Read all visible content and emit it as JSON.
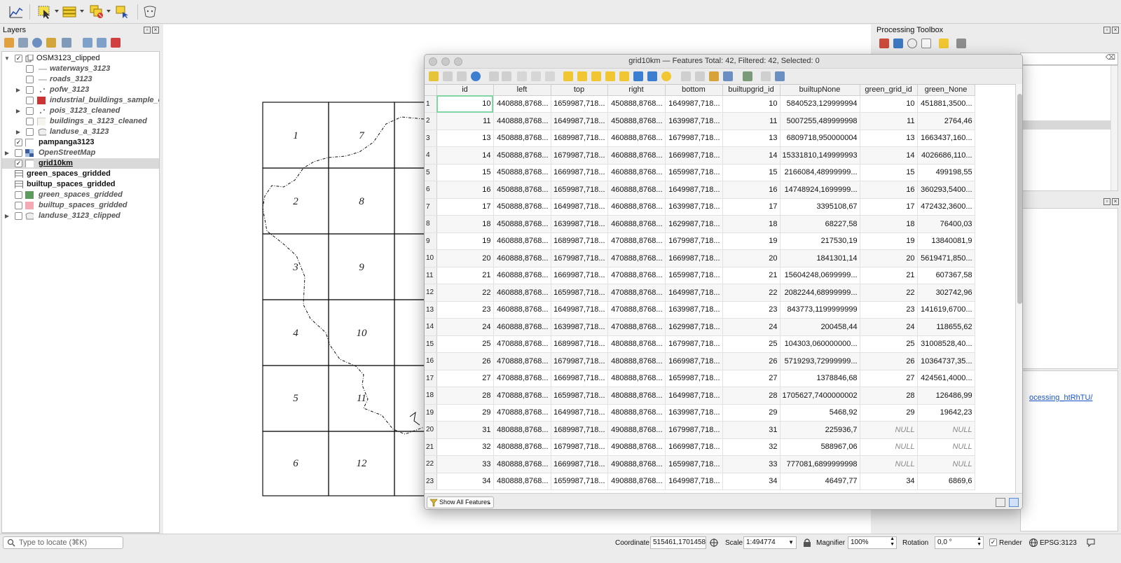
{
  "layers": {
    "title": "Layers",
    "items": [
      {
        "label": "OSM3123_clipped"
      },
      {
        "label": "waterways_3123"
      },
      {
        "label": "roads_3123"
      },
      {
        "label": "pofw_3123"
      },
      {
        "label": "industrial_buildings_sample_cl"
      },
      {
        "label": "pois_3123_cleaned"
      },
      {
        "label": "buildings_a_3123_cleaned"
      },
      {
        "label": "landuse_a_3123"
      },
      {
        "label": "pampanga3123"
      },
      {
        "label": "OpenStreetMap"
      },
      {
        "label": "grid10km"
      },
      {
        "label": "green_spaces_gridded"
      },
      {
        "label": "builtup_spaces_gridded"
      },
      {
        "label": "green_spaces_gridded"
      },
      {
        "label": "builtup_spaces_gridded"
      },
      {
        "label": "landuse_3123_clipped"
      }
    ]
  },
  "map": {
    "cells": [
      "1",
      "2",
      "3",
      "4",
      "5",
      "6",
      "7",
      "8",
      "9",
      "10",
      "11",
      "12"
    ]
  },
  "processing": {
    "title": "Processing Toolbox",
    "link_text": "ocessing_htRhTU/"
  },
  "attr": {
    "title": "grid10km — Features Total: 42, Filtered: 42, Selected: 0",
    "columns": [
      "id",
      "left",
      "top",
      "right",
      "bottom",
      "builtupgrid_id",
      "builtupNone",
      "green_grid_id",
      "green_None"
    ],
    "rows": [
      [
        "1",
        "10",
        "440888,8768...",
        "1659987,718...",
        "450888,8768...",
        "1649987,718...",
        "10",
        "5840523,129999994",
        "10",
        "451881,3500..."
      ],
      [
        "2",
        "11",
        "440888,8768...",
        "1649987,718...",
        "450888,8768...",
        "1639987,718...",
        "11",
        "5007255,489999998",
        "11",
        "2764,46"
      ],
      [
        "3",
        "13",
        "450888,8768...",
        "1689987,718...",
        "460888,8768...",
        "1679987,718...",
        "13",
        "6809718,950000004",
        "13",
        "1663437,160..."
      ],
      [
        "4",
        "14",
        "450888,8768...",
        "1679987,718...",
        "460888,8768...",
        "1669987,718...",
        "14",
        "15331810,149999993",
        "14",
        "4026686,110..."
      ],
      [
        "5",
        "15",
        "450888,8768...",
        "1669987,718...",
        "460888,8768...",
        "1659987,718...",
        "15",
        "2166084,48999999...",
        "15",
        "499198,55"
      ],
      [
        "6",
        "16",
        "450888,8768...",
        "1659987,718...",
        "460888,8768...",
        "1649987,718...",
        "16",
        "14748924,1699999...",
        "16",
        "360293,5400..."
      ],
      [
        "7",
        "17",
        "450888,8768...",
        "1649987,718...",
        "460888,8768...",
        "1639987,718...",
        "17",
        "3395108,67",
        "17",
        "472432,3600..."
      ],
      [
        "8",
        "18",
        "450888,8768...",
        "1639987,718...",
        "460888,8768...",
        "1629987,718...",
        "18",
        "68227,58",
        "18",
        "76400,03"
      ],
      [
        "9",
        "19",
        "460888,8768...",
        "1689987,718...",
        "470888,8768...",
        "1679987,718...",
        "19",
        "217530,19",
        "19",
        "13840081,9"
      ],
      [
        "10",
        "20",
        "460888,8768...",
        "1679987,718...",
        "470888,8768...",
        "1669987,718...",
        "20",
        "1841301,14",
        "20",
        "5619471,850..."
      ],
      [
        "11",
        "21",
        "460888,8768...",
        "1669987,718...",
        "470888,8768...",
        "1659987,718...",
        "21",
        "15604248,0699999...",
        "21",
        "607367,58"
      ],
      [
        "12",
        "22",
        "460888,8768...",
        "1659987,718...",
        "470888,8768...",
        "1649987,718...",
        "22",
        "2082244,68999999...",
        "22",
        "302742,96"
      ],
      [
        "13",
        "23",
        "460888,8768...",
        "1649987,718...",
        "470888,8768...",
        "1639987,718...",
        "23",
        "843773,1199999999",
        "23",
        "141619,6700..."
      ],
      [
        "14",
        "24",
        "460888,8768...",
        "1639987,718...",
        "470888,8768...",
        "1629987,718...",
        "24",
        "200458,44",
        "24",
        "118655,62"
      ],
      [
        "15",
        "25",
        "470888,8768...",
        "1689987,718...",
        "480888,8768...",
        "1679987,718...",
        "25",
        "104303,060000000...",
        "25",
        "31008528,40..."
      ],
      [
        "16",
        "26",
        "470888,8768...",
        "1679987,718...",
        "480888,8768...",
        "1669987,718...",
        "26",
        "5719293,72999999...",
        "26",
        "10364737,35..."
      ],
      [
        "17",
        "27",
        "470888,8768...",
        "1669987,718...",
        "480888,8768...",
        "1659987,718...",
        "27",
        "1378846,68",
        "27",
        "424561,4000..."
      ],
      [
        "18",
        "28",
        "470888,8768...",
        "1659987,718...",
        "480888,8768...",
        "1649987,718...",
        "28",
        "1705627,7400000002",
        "28",
        "126486,99"
      ],
      [
        "19",
        "29",
        "470888,8768...",
        "1649987,718...",
        "480888,8768...",
        "1639987,718...",
        "29",
        "5468,92",
        "29",
        "19642,23"
      ],
      [
        "20",
        "31",
        "480888,8768...",
        "1689987,718...",
        "490888,8768...",
        "1679987,718...",
        "31",
        "225936,7",
        "NULL",
        "NULL"
      ],
      [
        "21",
        "32",
        "480888,8768...",
        "1679987,718...",
        "490888,8768...",
        "1669987,718...",
        "32",
        "588967,06",
        "NULL",
        "NULL"
      ],
      [
        "22",
        "33",
        "480888,8768...",
        "1669987,718...",
        "490888,8768...",
        "1659987,718...",
        "33",
        "777081,6899999998",
        "NULL",
        "NULL"
      ],
      [
        "23",
        "34",
        "480888,8768...",
        "1659987,718...",
        "490888,8768...",
        "1649987,718...",
        "34",
        "46497,77",
        "34",
        "6869,6"
      ]
    ],
    "show_all": "Show All Features"
  },
  "status": {
    "locate_placeholder": "Type to locate (⌘K)",
    "coordinate_label": "Coordinate",
    "coordinate_value": "515461,1701458",
    "scale_label": "Scale",
    "scale_value": "1:494774",
    "magnifier_label": "Magnifier",
    "magnifier_value": "100%",
    "rotation_label": "Rotation",
    "rotation_value": "0,0 °",
    "render_label": "Render",
    "crs": "EPSG:3123"
  },
  "colors": {
    "industrial": "#cc3333",
    "green": "#5f9a5f",
    "builtup": "#f4a9b4",
    "link": "#1a55c9"
  }
}
